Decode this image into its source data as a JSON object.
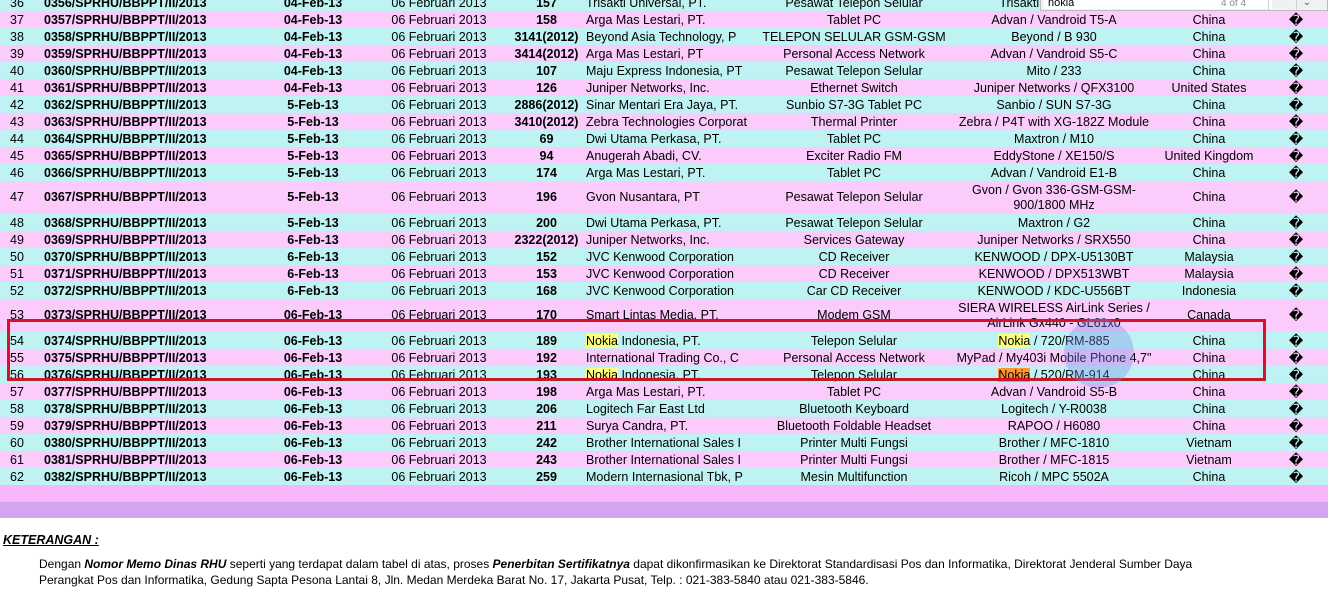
{
  "find_bar": {
    "query": "nokia",
    "count": "4 of 4",
    "prev_symbol": "⌃",
    "next_symbol": "⌄"
  },
  "rows": [
    {
      "no": "36",
      "memo": "0356/SPRHU/BBPPT/II/2013",
      "date": "04-Feb-13",
      "cert": "06 Februari 2013",
      "num": "157",
      "company": "Trisakti Universal, PT.",
      "device": "Pesawat Telepon Selular",
      "model": "Trisakti / AdvanMan",
      "country": "China",
      "mark": "�"
    },
    {
      "no": "37",
      "memo": "0357/SPRHU/BBPPT/II/2013",
      "date": "04-Feb-13",
      "cert": "06 Februari 2013",
      "num": "158",
      "company": "Arga Mas Lestari, PT.",
      "device": "Tablet PC",
      "model": "Advan / Vandroid T5-A",
      "country": "China",
      "mark": "�"
    },
    {
      "no": "38",
      "memo": "0358/SPRHU/BBPPT/II/2013",
      "date": "04-Feb-13",
      "cert": "06 Februari 2013",
      "num": "3141(2012)",
      "company": "Beyond Asia Technology, P",
      "device": "TELEPON SELULAR GSM-GSM",
      "model": "Beyond / B 930",
      "country": "China",
      "mark": "�"
    },
    {
      "no": "39",
      "memo": "0359/SPRHU/BBPPT/II/2013",
      "date": "04-Feb-13",
      "cert": "06 Februari 2013",
      "num": "3414(2012)",
      "company": "Arga Mas Lestari, PT",
      "device": "Personal Access Network",
      "model": "Advan / Vandroid S5-C",
      "country": "China",
      "mark": "�"
    },
    {
      "no": "40",
      "memo": "0360/SPRHU/BBPPT/II/2013",
      "date": "04-Feb-13",
      "cert": "06 Februari 2013",
      "num": "107",
      "company": "Maju Express Indonesia, PT",
      "device": "Pesawat Telepon Selular",
      "model": "Mito / 233",
      "country": "China",
      "mark": "�"
    },
    {
      "no": "41",
      "memo": "0361/SPRHU/BBPPT/II/2013",
      "date": "04-Feb-13",
      "cert": "06 Februari 2013",
      "num": "126",
      "company": "Juniper Networks, Inc.",
      "device": "Ethernet Switch",
      "model": "Juniper Networks / QFX3100",
      "country": "United States",
      "mark": "�"
    },
    {
      "no": "42",
      "memo": "0362/SPRHU/BBPPT/II/2013",
      "date": "5-Feb-13",
      "cert": "06 Februari 2013",
      "num": "2886(2012)",
      "company": "Sinar Mentari Era Jaya, PT.",
      "device": "Sunbio S7-3G Tablet PC",
      "model": "Sanbio / SUN S7-3G",
      "country": "China",
      "mark": "�"
    },
    {
      "no": "43",
      "memo": "0363/SPRHU/BBPPT/II/2013",
      "date": "5-Feb-13",
      "cert": "06 Februari 2013",
      "num": "3410(2012)",
      "company": "Zebra Technologies Corporat",
      "device": "Thermal Printer",
      "model": "Zebra / P4T with XG-182Z Module",
      "country": "China",
      "mark": "�"
    },
    {
      "no": "44",
      "memo": "0364/SPRHU/BBPPT/II/2013",
      "date": "5-Feb-13",
      "cert": "06 Februari 2013",
      "num": "69",
      "company": "Dwi Utama Perkasa, PT.",
      "device": "Tablet PC",
      "model": "Maxtron / M10",
      "country": "China",
      "mark": "�"
    },
    {
      "no": "45",
      "memo": "0365/SPRHU/BBPPT/II/2013",
      "date": "5-Feb-13",
      "cert": "06 Februari 2013",
      "num": "94",
      "company": "Anugerah Abadi, CV.",
      "device": "Exciter Radio FM",
      "model": "EddyStone / XE150/S",
      "country": "United Kingdom",
      "mark": "�"
    },
    {
      "no": "46",
      "memo": "0366/SPRHU/BBPPT/II/2013",
      "date": "5-Feb-13",
      "cert": "06 Februari 2013",
      "num": "174",
      "company": "Arga Mas Lestari, PT.",
      "device": "Tablet PC",
      "model": "Advan / Vandroid E1-B",
      "country": "China",
      "mark": "�"
    },
    {
      "no": "47",
      "memo": "0367/SPRHU/BBPPT/II/2013",
      "date": "5-Feb-13",
      "cert": "06 Februari 2013",
      "num": "196",
      "company": "Gvon Nusantara, PT",
      "device": "Pesawat Telepon Selular",
      "model": "Gvon / Gvon 336-GSM-GSM-900/1800 MHz",
      "country": "China",
      "mark": "�",
      "tall": true
    },
    {
      "no": "48",
      "memo": "0368/SPRHU/BBPPT/II/2013",
      "date": "5-Feb-13",
      "cert": "06 Februari 2013",
      "num": "200",
      "company": "Dwi Utama Perkasa, PT.",
      "device": "Pesawat Telepon Selular",
      "model": "Maxtron / G2",
      "country": "China",
      "mark": "�"
    },
    {
      "no": "49",
      "memo": "0369/SPRHU/BBPPT/II/2013",
      "date": "6-Feb-13",
      "cert": "06 Februari 2013",
      "num": "2322(2012)",
      "company": "Juniper Networks, Inc.",
      "device": "Services Gateway",
      "model": "Juniper Networks / SRX550",
      "country": "China",
      "mark": "�"
    },
    {
      "no": "50",
      "memo": "0370/SPRHU/BBPPT/II/2013",
      "date": "6-Feb-13",
      "cert": "06 Februari 2013",
      "num": "152",
      "company": "JVC Kenwood Corporation",
      "device": "CD Receiver",
      "model": "KENWOOD / DPX-U5130BT",
      "country": "Malaysia",
      "mark": "�"
    },
    {
      "no": "51",
      "memo": "0371/SPRHU/BBPPT/II/2013",
      "date": "6-Feb-13",
      "cert": "06 Februari 2013",
      "num": "153",
      "company": "JVC Kenwood Corporation",
      "device": "CD Receiver",
      "model": "KENWOOD / DPX513WBT",
      "country": "Malaysia",
      "mark": "�"
    },
    {
      "no": "52",
      "memo": "0372/SPRHU/BBPPT/II/2013",
      "date": "6-Feb-13",
      "cert": "06 Februari 2013",
      "num": "168",
      "company": "JVC Kenwood Corporation",
      "device": "Car CD Receiver",
      "model": "KENWOOD / KDC-U556BT",
      "country": "Indonesia",
      "mark": "�"
    },
    {
      "no": "53",
      "memo": "0373/SPRHU/BBPPT/II/2013",
      "date": "06-Feb-13",
      "cert": "06 Februari 2013",
      "num": "170",
      "company": "Smart Lintas Media, PT.",
      "device": "Modem GSM",
      "model": "SIERA WIRELESS AirLink Series / AirLink Gx440 - GL61x0",
      "country": "Canada",
      "mark": "�",
      "tall": true
    },
    {
      "no": "54",
      "memo": "0374/SPRHU/BBPPT/II/2013",
      "date": "06-Feb-13",
      "cert": "06 Februari 2013",
      "num": "189",
      "company_hl": "Nokia",
      "company": " Indonesia, PT.",
      "device": "Telepon Selular",
      "model_hl": "Nokia",
      "model": " / 720/RM-885",
      "country": "China",
      "mark": "�"
    },
    {
      "no": "55",
      "memo": "0375/SPRHU/BBPPT/II/2013",
      "date": "06-Feb-13",
      "cert": "06 Februari 2013",
      "num": "192",
      "company": "International Trading Co., C",
      "device": "Personal Access Network",
      "model": "MyPad / My403i Mobile Phone 4,7\"",
      "country": "China",
      "mark": "�"
    },
    {
      "no": "56",
      "memo": "0376/SPRHU/BBPPT/II/2013",
      "date": "06-Feb-13",
      "cert": "06 Februari 2013",
      "num": "193",
      "company_hl": "Nokia",
      "company": " Indonesia, PT.",
      "device": "Telepon Selular",
      "model_hl_cur": "Nokia",
      "model": " / 520/RM-914",
      "country": "China",
      "mark": "�"
    },
    {
      "no": "57",
      "memo": "0377/SPRHU/BBPPT/II/2013",
      "date": "06-Feb-13",
      "cert": "06 Februari 2013",
      "num": "198",
      "company": "Arga Mas Lestari, PT.",
      "device": "Tablet PC",
      "model": "Advan / Vandroid S5-B",
      "country": "China",
      "mark": "�"
    },
    {
      "no": "58",
      "memo": "0378/SPRHU/BBPPT/II/2013",
      "date": "06-Feb-13",
      "cert": "06 Februari 2013",
      "num": "206",
      "company": "Logitech Far East Ltd",
      "device": "Bluetooth Keyboard",
      "model": "Logitech / Y-R0038",
      "country": "China",
      "mark": "�"
    },
    {
      "no": "59",
      "memo": "0379/SPRHU/BBPPT/II/2013",
      "date": "06-Feb-13",
      "cert": "06 Februari 2013",
      "num": "211",
      "company": "Surya Candra, PT.",
      "device": "Bluetooth Foldable Headset",
      "model": "RAPOO / H6080",
      "country": "China",
      "mark": "�"
    },
    {
      "no": "60",
      "memo": "0380/SPRHU/BBPPT/II/2013",
      "date": "06-Feb-13",
      "cert": "06 Februari 2013",
      "num": "242",
      "company": "Brother International Sales I",
      "device": "Printer Multi Fungsi",
      "model": "Brother / MFC-1810",
      "country": "Vietnam",
      "mark": "�"
    },
    {
      "no": "61",
      "memo": "0381/SPRHU/BBPPT/II/2013",
      "date": "06-Feb-13",
      "cert": "06 Februari 2013",
      "num": "243",
      "company": "Brother International Sales I",
      "device": "Printer Multi Fungsi",
      "model": "Brother / MFC-1815",
      "country": "Vietnam",
      "mark": "�"
    },
    {
      "no": "62",
      "memo": "0382/SPRHU/BBPPT/II/2013",
      "date": "06-Feb-13",
      "cert": "06 Februari 2013",
      "num": "259",
      "company": "Modern Internasional Tbk, P",
      "device": "Mesin Multifunction",
      "model": "Ricoh / MPC 5502A",
      "country": "China",
      "mark": "�"
    }
  ],
  "footer": {
    "heading": "KETERANGAN :",
    "text_1": "Dengan ",
    "bold_1": "Nomor Memo Dinas RHU",
    "text_2": " seperti yang terdapat dalam tabel di atas, proses ",
    "bold_2": "Penerbitan Sertifikatnya",
    "text_3": " dapat dikonfirmasikan ke Direktorat Standardisasi Pos dan Informatika, Direktorat Jenderal Sumber Daya",
    "line_2": "Perangkat Pos dan Informatika, Gedung Sapta Pesona Lantai 8, Jln. Medan Merdeka Barat No. 17, Jakarta Pusat, Telp. : 021-383-5840 atau 021-383-5846."
  },
  "colors": {
    "row_odd": "#bff2f2",
    "row_even": "#fbcbfb",
    "find_highlight": "#ffff7f",
    "find_current": "#ff9632",
    "box": "#d4122a"
  }
}
